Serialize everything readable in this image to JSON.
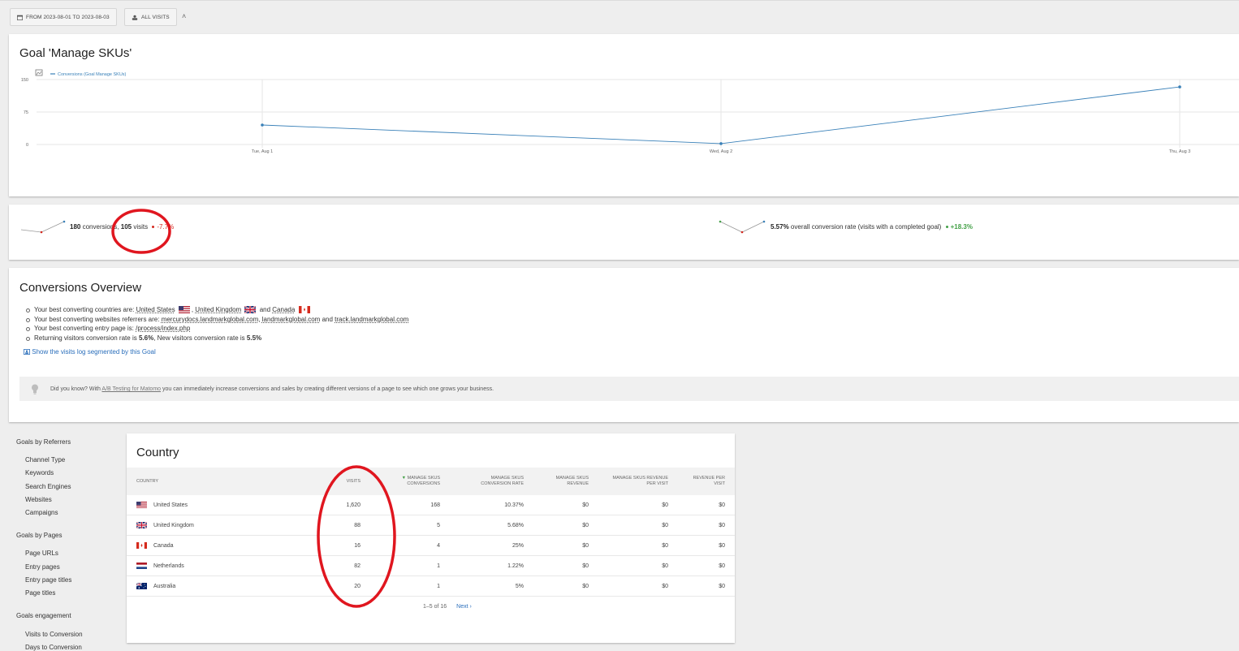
{
  "toolbar": {
    "period_label": "FROM 2023-08-01 TO 2023-08-03",
    "segment_label": "ALL VISITS"
  },
  "graph": {
    "title": "Goal 'Manage SKUs'",
    "legend_series": "Conversions (Goal Manage SKUs)",
    "series_color": "#3980b8"
  },
  "chart_data": {
    "type": "line",
    "categories": [
      "Tue, Aug 1",
      "Wed, Aug 2",
      "Thu, Aug 3"
    ],
    "series": [
      {
        "name": "Conversions (Goal Manage SKUs)",
        "values": [
          45,
          2,
          133
        ]
      }
    ],
    "ylim": [
      0,
      150
    ],
    "yticks": [
      "150",
      "75",
      "0"
    ],
    "grid": true,
    "legend": "top-left"
  },
  "sparklines": {
    "conv_value": "180",
    "conv_text": "conversions,",
    "visits_value": "105",
    "visits_text": "visits",
    "conv_change": "-7.7%",
    "rate_value": "5.57%",
    "rate_text": "overall conversion rate (visits with a completed goal)",
    "rate_change": "+18.3%"
  },
  "overview": {
    "title": "Conversions Overview",
    "countries_prefix": "Your best converting countries are:",
    "country_1": "United States",
    "country_2": "United Kingdom",
    "and": "and",
    "country_3": "Canada",
    "referrers_prefix": "Your best converting websites referrers are:",
    "referrer_1": "mercurydocs.landmarkglobal.com",
    "referrer_2": "landmarkglobal.com",
    "referrer_3": "track.landmarkglobal.com",
    "entry_prefix": "Your best converting entry page is:",
    "entry_page": "/process/index.php",
    "returning_prefix": "Returning visitors conversion rate is",
    "returning_rate": "5.6%",
    "new_prefix": "New visitors conversion rate is",
    "new_rate": "5.5%",
    "segment_link": "Show the visits log segmented by this Goal",
    "tip_prefix": "Did you know? With",
    "tip_link": "A/B Testing for Matomo",
    "tip_suffix": "you can immediately increase conversions and sales by creating different versions of a page to see which one grows your business."
  },
  "subnav": {
    "referrers_head": "Goals by Referrers",
    "referrers": [
      "Channel Type",
      "Keywords",
      "Search Engines",
      "Websites",
      "Campaigns"
    ],
    "pages_head": "Goals by Pages",
    "pages": [
      "Page URLs",
      "Entry pages",
      "Entry page titles",
      "Page titles"
    ],
    "engagement_head": "Goals engagement",
    "engagement": [
      "Visits to Conversion",
      "Days to Conversion"
    ]
  },
  "country_table": {
    "title": "Country",
    "columns": {
      "country": "COUNTRY",
      "visits": "VISITS",
      "conversions": "MANAGE SKUS CONVERSIONS",
      "rate": "MANAGE SKUS CONVERSION RATE",
      "revenue": "MANAGE SKUS REVENUE",
      "revenue_per_visit": "MANAGE SKUS REVENUE PER VISIT",
      "rev_per_visit": "REVENUE PER VISIT"
    },
    "rows": [
      {
        "country": "United States",
        "flag": "us",
        "visits": "1,620",
        "conversions": "168",
        "rate": "10.37%",
        "revenue": "$0",
        "revenue_per_visit": "$0",
        "rev_per_visit": "$0"
      },
      {
        "country": "United Kingdom",
        "flag": "gb",
        "visits": "88",
        "conversions": "5",
        "rate": "5.68%",
        "revenue": "$0",
        "revenue_per_visit": "$0",
        "rev_per_visit": "$0"
      },
      {
        "country": "Canada",
        "flag": "ca",
        "visits": "16",
        "conversions": "4",
        "rate": "25%",
        "revenue": "$0",
        "revenue_per_visit": "$0",
        "rev_per_visit": "$0"
      },
      {
        "country": "Netherlands",
        "flag": "nl",
        "visits": "82",
        "conversions": "1",
        "rate": "1.22%",
        "revenue": "$0",
        "revenue_per_visit": "$0",
        "rev_per_visit": "$0"
      },
      {
        "country": "Australia",
        "flag": "au",
        "visits": "20",
        "conversions": "1",
        "rate": "5%",
        "revenue": "$0",
        "revenue_per_visit": "$0",
        "rev_per_visit": "$0"
      }
    ],
    "pager_range": "1–5 of 16",
    "pager_next": "Next ›"
  },
  "colors": {
    "accent": "#3980b8",
    "negative": "#d4291f",
    "positive": "#43a047",
    "annotation": "#e0161f"
  }
}
